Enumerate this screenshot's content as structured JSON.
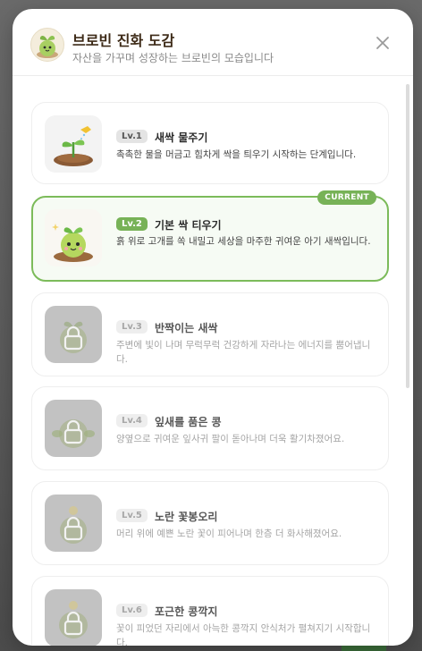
{
  "header": {
    "title": "브로빈 진화 도감",
    "subtitle": "자산을 가꾸며 성장하는 브로빈의 모습입니다"
  },
  "current_badge": "CURRENT",
  "stages": [
    {
      "level": "Lv.1",
      "name": "새싹 물주기",
      "description": "촉촉한 물을 머금고 힘차게 싹을 틔우기 시작하는 단계입니다.",
      "status": "unlocked"
    },
    {
      "level": "Lv.2",
      "name": "기본 싹 티우기",
      "description": "흙 위로 고개를 쏙 내밀고 세상을 마주한 귀여운 아기 새싹입니다.",
      "status": "current"
    },
    {
      "level": "Lv.3",
      "name": "반짝이는 새싹",
      "description": "주변에 빛이 나며 무럭무럭 건강하게 자라나는 에너지를 뿜어냅니다.",
      "status": "locked"
    },
    {
      "level": "Lv.4",
      "name": "잎새를 품은 콩",
      "description": "양옆으로 귀여운 잎사귀 팔이 돋아나며 더욱 활기차졌어요.",
      "status": "locked"
    },
    {
      "level": "Lv.5",
      "name": "노란 꽃봉오리",
      "description": "머리 위에 예쁜 노란 꽃이 피어나며 한층 더 화사해졌어요.",
      "status": "locked"
    },
    {
      "level": "Lv.6",
      "name": "포근한 콩깍지",
      "description": "꽃이 피었던 자리에서 아늑한 콩깍지 안식처가 펼쳐지기 시작합니다.",
      "status": "locked"
    }
  ]
}
